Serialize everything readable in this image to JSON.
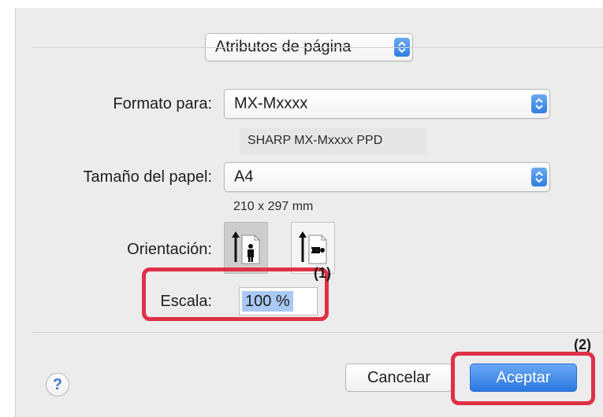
{
  "dialog": {
    "section_popup": {
      "label": "Atributos de página"
    },
    "format_for": {
      "label": "Formato para:",
      "value": "MX-Mxxxx",
      "description": "SHARP MX-Mxxxx PPD"
    },
    "paper_size": {
      "label": "Tamaño del papel:",
      "value": "A4",
      "dimensions": "210 x 297 mm"
    },
    "orientation": {
      "label": "Orientación:",
      "options": [
        {
          "name": "portrait",
          "selected": true
        },
        {
          "name": "landscape",
          "selected": false
        }
      ]
    },
    "scale": {
      "label": "Escala:",
      "value": "100 %"
    },
    "buttons": {
      "help": "?",
      "cancel": "Cancelar",
      "accept": "Aceptar"
    }
  },
  "annotations": {
    "callout_1": "(1)",
    "callout_2": "(2)",
    "highlight_color": "#de3047"
  },
  "colors": {
    "accent": "#2f7ee0",
    "dialog_background": "#ececec",
    "selection": "#a9c8f4"
  },
  "icons": {
    "stepper": "up-down-chevron-icon",
    "portrait": "portrait-orientation-icon",
    "landscape": "landscape-orientation-icon",
    "help": "question-mark-icon"
  }
}
